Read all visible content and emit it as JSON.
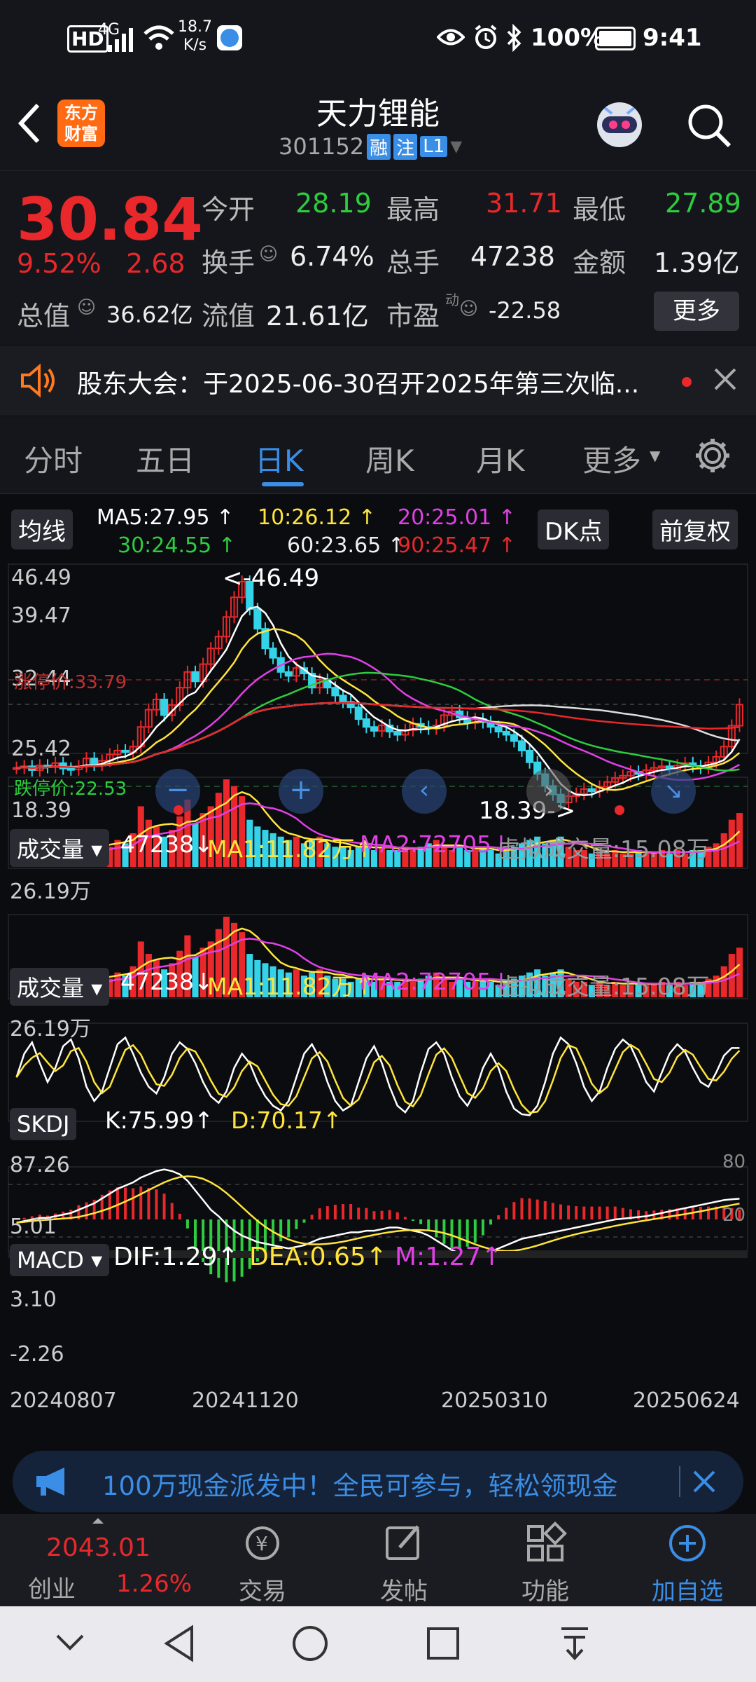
{
  "status_bar": {
    "hd": "HD",
    "net": "4G",
    "speed": "18.7",
    "speed_unit": "K/s",
    "battery": "100%",
    "time": "9:41"
  },
  "header": {
    "logo_line1": "东方",
    "logo_line2": "财富",
    "title": "天力锂能",
    "code": "301152",
    "badge_rong": "融",
    "badge_zhu": "注",
    "badge_l1": "L1"
  },
  "quote": {
    "price": "30.84",
    "change_pct": "9.52%",
    "change": "2.68",
    "open_label": "今开",
    "open": "28.19",
    "high_label": "最高",
    "high": "31.71",
    "low_label": "最低",
    "low": "27.89",
    "turnover_label": "换手",
    "turnover": "6.74%",
    "volume_label": "总手",
    "volume": "47238",
    "amount_label": "金额",
    "amount": "1.39亿",
    "mktcap_label": "总值",
    "mktcap": "36.62亿",
    "float_label": "流值",
    "float": "21.61亿",
    "pe_label": "市盈",
    "pe_sup": "动",
    "pe": "-22.58",
    "more": "更多"
  },
  "notice": {
    "text": "股东大会：于2025-06-30召开2025年第三次临..."
  },
  "tabs": [
    "分时",
    "五日",
    "日K",
    "周K",
    "月K",
    "更多"
  ],
  "ma_legend": {
    "label": "均线",
    "ma5": "MA5:27.95 ↑",
    "ma10": "10:26.12 ↑",
    "ma20": "20:25.01 ↑",
    "ma30": "30:24.55 ↑",
    "ma60": "60:23.65 ↑",
    "ma90": "90:25.47 ↑",
    "dk": "DK点",
    "fq": "前复权"
  },
  "kline": {
    "y_labels": [
      "46.49",
      "39.47",
      "32.44",
      "25.42",
      "18.39"
    ],
    "limit_up": "涨停价:33.79",
    "limit_down": "跌停价:22.53",
    "max_mark": "<-46.49",
    "min_mark": "18.39->"
  },
  "vol1": {
    "label": "成交量",
    "v": "47238",
    "ma1": "MA1:11.82万",
    "ma2": "MA2:72705",
    "virtual": "虚拟成交量:15.08万",
    "ymax": "26.19万"
  },
  "vol2": {
    "label": "成交量",
    "v": "47238",
    "ma1": "MA1:11.82万",
    "ma2": "MA2:72705",
    "virtual": "虚拟成交量:15.08万",
    "ymax": "26.19万"
  },
  "skdj": {
    "label": "SKDJ",
    "k": "K:75.99",
    "d": "D:70.17",
    "ymax": "87.26",
    "ymin": "5.01",
    "r80": "80",
    "r20": "20"
  },
  "macd": {
    "label": "MACD",
    "dif": "DIF:1.29",
    "dea": "DEA:0.65",
    "m": "M:1.27",
    "ymax": "3.10",
    "ymin": "-2.26"
  },
  "dates": [
    "20240807",
    "20241120",
    "20250310",
    "20250624"
  ],
  "banner": {
    "text": "100万现金派发中！全民可参与，轻松领现金"
  },
  "bottom_nav": {
    "index_value": "2043.01",
    "index_name": "创业",
    "index_pct": "1.26%",
    "trade": "交易",
    "post": "发帖",
    "func": "功能",
    "add": "加自选"
  },
  "colors": {
    "up": "#e8282b",
    "down": "#2ecc3f",
    "accent": "#3a8ee6",
    "bg": "#0b0c10"
  },
  "series": {
    "price": [
      22.8,
      23.0,
      22.5,
      23.1,
      22.9,
      23.4,
      22.7,
      22.6,
      23.0,
      24.0,
      23.2,
      23.7,
      24.5,
      25.0,
      24.8,
      25.5,
      28.0,
      30.2,
      31.5,
      29.5,
      30.8,
      33.0,
      35.0,
      33.8,
      36.0,
      38.0,
      39.5,
      42.0,
      44.5,
      46.49,
      43.0,
      40.5,
      38.0,
      36.8,
      35.0,
      34.5,
      35.5,
      34.8,
      33.0,
      34.0,
      33.0,
      32.0,
      31.2,
      30.5,
      29.0,
      28.0,
      27.5,
      28.2,
      27.4,
      27.0,
      27.6,
      28.4,
      28.0,
      27.8,
      28.2,
      29.5,
      30.0,
      29.2,
      28.5,
      29.0,
      28.6,
      28.0,
      27.4,
      27.0,
      26.2,
      25.0,
      23.5,
      22.0,
      20.5,
      19.4,
      18.39,
      19.2,
      19.5,
      20.1,
      19.8,
      20.4,
      21.0,
      21.5,
      21.8,
      22.3,
      22.0,
      22.5,
      22.8,
      23.0,
      22.6,
      23.1,
      23.4,
      23.0,
      22.8,
      23.5,
      24.2,
      25.5,
      28.16,
      30.84
    ],
    "vol": [
      4,
      3,
      4,
      3,
      5,
      4,
      3,
      4,
      6,
      5,
      7,
      9,
      6,
      8,
      7,
      10,
      18,
      14,
      12,
      9,
      11,
      15,
      20,
      13,
      16,
      18,
      22,
      26,
      24,
      21,
      14,
      12,
      11,
      10,
      9,
      8,
      9,
      7,
      8,
      9,
      7,
      6,
      6,
      5,
      6,
      7,
      5,
      6,
      5,
      5,
      6,
      5,
      6,
      7,
      8,
      6,
      5,
      6,
      5,
      5,
      6,
      5,
      4,
      5,
      6,
      7,
      8,
      9,
      7,
      8,
      9,
      6,
      5,
      5,
      4,
      5,
      4,
      5,
      4,
      4,
      5,
      4,
      4,
      5,
      4,
      5,
      4,
      5,
      5,
      6,
      7,
      10,
      14,
      16
    ],
    "skdj_k": [
      45,
      70,
      82,
      60,
      40,
      55,
      78,
      85,
      65,
      35,
      20,
      30,
      55,
      80,
      87,
      70,
      50,
      35,
      28,
      45,
      70,
      82,
      75,
      60,
      40,
      25,
      18,
      30,
      55,
      70,
      60,
      40,
      25,
      15,
      10,
      20,
      45,
      70,
      80,
      65,
      40,
      20,
      10,
      15,
      40,
      65,
      78,
      60,
      35,
      15,
      8,
      20,
      50,
      75,
      82,
      70,
      45,
      25,
      15,
      30,
      55,
      70,
      55,
      30,
      12,
      6,
      5,
      15,
      40,
      70,
      87,
      80,
      60,
      35,
      20,
      30,
      55,
      75,
      85,
      78,
      60,
      40,
      30,
      50,
      70,
      80,
      72,
      55,
      40,
      35,
      50,
      68,
      76,
      76
    ],
    "dif": [
      -0.2,
      -0.1,
      0,
      0.1,
      0.1,
      0.2,
      0.3,
      0.4,
      0.6,
      0.8,
      1.0,
      1.3,
      1.6,
      1.9,
      2.1,
      2.3,
      2.6,
      2.8,
      3.0,
      3.1,
      3.0,
      2.8,
      2.4,
      1.8,
      1.2,
      0.6,
      0.2,
      -0.3,
      -0.7,
      -1.0,
      -1.2,
      -1.4,
      -1.5,
      -1.6,
      -1.7,
      -1.8,
      -1.7,
      -1.6,
      -1.4,
      -1.2,
      -1.1,
      -1.0,
      -0.9,
      -0.8,
      -0.8,
      -0.7,
      -0.7,
      -0.6,
      -0.5,
      -0.5,
      -0.6,
      -0.7,
      -0.8,
      -1.0,
      -1.3,
      -1.6,
      -1.9,
      -2.1,
      -2.2,
      -2.26,
      -2.2,
      -2.0,
      -1.8,
      -1.6,
      -1.4,
      -1.2,
      -1.1,
      -1.0,
      -0.9,
      -0.8,
      -0.7,
      -0.6,
      -0.5,
      -0.4,
      -0.3,
      -0.2,
      -0.1,
      0,
      0.05,
      0.1,
      0.15,
      0.2,
      0.3,
      0.4,
      0.5,
      0.6,
      0.7,
      0.8,
      0.9,
      1.0,
      1.1,
      1.2,
      1.25,
      1.29
    ]
  }
}
